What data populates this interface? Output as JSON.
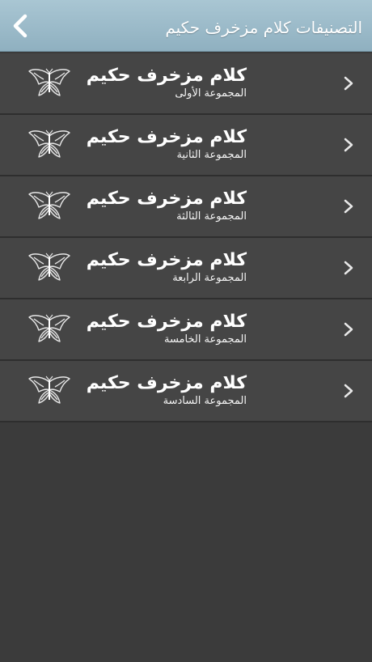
{
  "header": {
    "title": "التصنيفات كلام مزخرف حكيم",
    "back_icon": "chevron-left-icon"
  },
  "list": {
    "items": [
      {
        "title": "كلام مزخرف حكيم",
        "subtitle": "المجموعة الأولى",
        "icon": "butterfly-icon"
      },
      {
        "title": "كلام مزخرف حكيم",
        "subtitle": "المجموعة الثانية",
        "icon": "butterfly-icon"
      },
      {
        "title": "كلام مزخرف حكيم",
        "subtitle": "المجموعة الثالثة",
        "icon": "butterfly-icon"
      },
      {
        "title": "كلام مزخرف حكيم",
        "subtitle": "المجموعة الرابعة",
        "icon": "butterfly-icon"
      },
      {
        "title": "كلام مزخرف حكيم",
        "subtitle": "المجموعة الخامسة",
        "icon": "butterfly-icon"
      },
      {
        "title": "كلام مزخرف حكيم",
        "subtitle": "المجموعة السادسة",
        "icon": "butterfly-icon"
      }
    ]
  },
  "colors": {
    "navbar": "#9dbccb",
    "background": "#3b3b3b",
    "row": "#454545",
    "separator": "#2e2e2e",
    "text": "#ffffff"
  }
}
